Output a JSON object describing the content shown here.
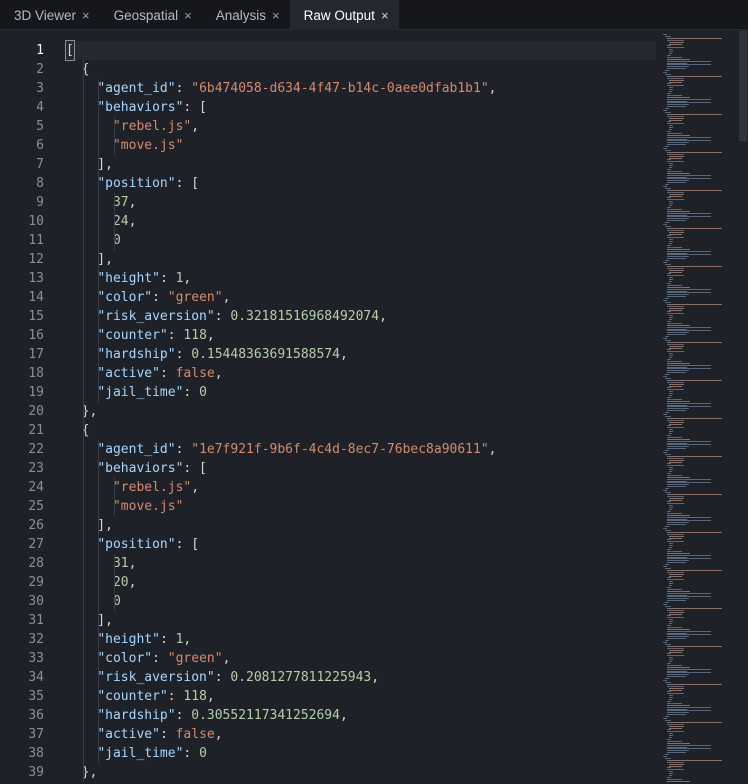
{
  "tabs": [
    {
      "label": "3D Viewer",
      "close": "×",
      "active": false
    },
    {
      "label": "Geospatial",
      "close": "×",
      "active": false
    },
    {
      "label": "Analysis",
      "close": "×",
      "active": false
    },
    {
      "label": "Raw Output",
      "close": "×",
      "active": true
    }
  ],
  "editor": {
    "current_line": 1,
    "lines": [
      [
        [
          "p",
          "["
        ]
      ],
      [
        [
          "p",
          "  {"
        ]
      ],
      [
        [
          "p",
          "    "
        ],
        [
          "k",
          "\"agent_id\""
        ],
        [
          "p",
          ": "
        ],
        [
          "s",
          "\"6b474058-d634-4f47-b14c-0aee0dfab1b1\""
        ],
        [
          "p",
          ","
        ]
      ],
      [
        [
          "p",
          "    "
        ],
        [
          "k",
          "\"behaviors\""
        ],
        [
          "p",
          ": ["
        ]
      ],
      [
        [
          "p",
          "      "
        ],
        [
          "s",
          "\"rebel.js\""
        ],
        [
          "p",
          ","
        ]
      ],
      [
        [
          "p",
          "      "
        ],
        [
          "s",
          "\"move.js\""
        ]
      ],
      [
        [
          "p",
          "    ],"
        ]
      ],
      [
        [
          "p",
          "    "
        ],
        [
          "k",
          "\"position\""
        ],
        [
          "p",
          ": ["
        ]
      ],
      [
        [
          "p",
          "      "
        ],
        [
          "n",
          "37"
        ],
        [
          "p",
          ","
        ]
      ],
      [
        [
          "p",
          "      "
        ],
        [
          "n",
          "24"
        ],
        [
          "p",
          ","
        ]
      ],
      [
        [
          "p",
          "      "
        ],
        [
          "n",
          "0"
        ]
      ],
      [
        [
          "p",
          "    ],"
        ]
      ],
      [
        [
          "p",
          "    "
        ],
        [
          "k",
          "\"height\""
        ],
        [
          "p",
          ": "
        ],
        [
          "n",
          "1"
        ],
        [
          "p",
          ","
        ]
      ],
      [
        [
          "p",
          "    "
        ],
        [
          "k",
          "\"color\""
        ],
        [
          "p",
          ": "
        ],
        [
          "s",
          "\"green\""
        ],
        [
          "p",
          ","
        ]
      ],
      [
        [
          "p",
          "    "
        ],
        [
          "k",
          "\"risk_aversion\""
        ],
        [
          "p",
          ": "
        ],
        [
          "n",
          "0.32181516968492074"
        ],
        [
          "p",
          ","
        ]
      ],
      [
        [
          "p",
          "    "
        ],
        [
          "k",
          "\"counter\""
        ],
        [
          "p",
          ": "
        ],
        [
          "n",
          "118"
        ],
        [
          "p",
          ","
        ]
      ],
      [
        [
          "p",
          "    "
        ],
        [
          "k",
          "\"hardship\""
        ],
        [
          "p",
          ": "
        ],
        [
          "n",
          "0.15448363691588574"
        ],
        [
          "p",
          ","
        ]
      ],
      [
        [
          "p",
          "    "
        ],
        [
          "k",
          "\"active\""
        ],
        [
          "p",
          ": "
        ],
        [
          "b",
          "false"
        ],
        [
          "p",
          ","
        ]
      ],
      [
        [
          "p",
          "    "
        ],
        [
          "k",
          "\"jail_time\""
        ],
        [
          "p",
          ": "
        ],
        [
          "n",
          "0"
        ]
      ],
      [
        [
          "p",
          "  },"
        ]
      ],
      [
        [
          "p",
          "  {"
        ]
      ],
      [
        [
          "p",
          "    "
        ],
        [
          "k",
          "\"agent_id\""
        ],
        [
          "p",
          ": "
        ],
        [
          "s",
          "\"1e7f921f-9b6f-4c4d-8ec7-76bec8a90611\""
        ],
        [
          "p",
          ","
        ]
      ],
      [
        [
          "p",
          "    "
        ],
        [
          "k",
          "\"behaviors\""
        ],
        [
          "p",
          ": ["
        ]
      ],
      [
        [
          "p",
          "      "
        ],
        [
          "s",
          "\"rebel.js\""
        ],
        [
          "p",
          ","
        ]
      ],
      [
        [
          "p",
          "      "
        ],
        [
          "s",
          "\"move.js\""
        ]
      ],
      [
        [
          "p",
          "    ],"
        ]
      ],
      [
        [
          "p",
          "    "
        ],
        [
          "k",
          "\"position\""
        ],
        [
          "p",
          ": ["
        ]
      ],
      [
        [
          "p",
          "      "
        ],
        [
          "n",
          "31"
        ],
        [
          "p",
          ","
        ]
      ],
      [
        [
          "p",
          "      "
        ],
        [
          "n",
          "20"
        ],
        [
          "p",
          ","
        ]
      ],
      [
        [
          "p",
          "      "
        ],
        [
          "n",
          "0"
        ]
      ],
      [
        [
          "p",
          "    ],"
        ]
      ],
      [
        [
          "p",
          "    "
        ],
        [
          "k",
          "\"height\""
        ],
        [
          "p",
          ": "
        ],
        [
          "n",
          "1"
        ],
        [
          "p",
          ","
        ]
      ],
      [
        [
          "p",
          "    "
        ],
        [
          "k",
          "\"color\""
        ],
        [
          "p",
          ": "
        ],
        [
          "s",
          "\"green\""
        ],
        [
          "p",
          ","
        ]
      ],
      [
        [
          "p",
          "    "
        ],
        [
          "k",
          "\"risk_aversion\""
        ],
        [
          "p",
          ": "
        ],
        [
          "n",
          "0.2081277811225943"
        ],
        [
          "p",
          ","
        ]
      ],
      [
        [
          "p",
          "    "
        ],
        [
          "k",
          "\"counter\""
        ],
        [
          "p",
          ": "
        ],
        [
          "n",
          "118"
        ],
        [
          "p",
          ","
        ]
      ],
      [
        [
          "p",
          "    "
        ],
        [
          "k",
          "\"hardship\""
        ],
        [
          "p",
          ": "
        ],
        [
          "n",
          "0.30552117341252694"
        ],
        [
          "p",
          ","
        ]
      ],
      [
        [
          "p",
          "    "
        ],
        [
          "k",
          "\"active\""
        ],
        [
          "p",
          ": "
        ],
        [
          "b",
          "false"
        ],
        [
          "p",
          ","
        ]
      ],
      [
        [
          "p",
          "    "
        ],
        [
          "k",
          "\"jail_time\""
        ],
        [
          "p",
          ": "
        ],
        [
          "n",
          "0"
        ]
      ],
      [
        [
          "p",
          "  },"
        ]
      ]
    ]
  },
  "colors": {
    "background": "#1f2128",
    "tabbar": "#16171c",
    "active_tab": "#252830",
    "key": "#a5d6ff",
    "string": "#d58a6e",
    "number": "#b5cea8"
  }
}
